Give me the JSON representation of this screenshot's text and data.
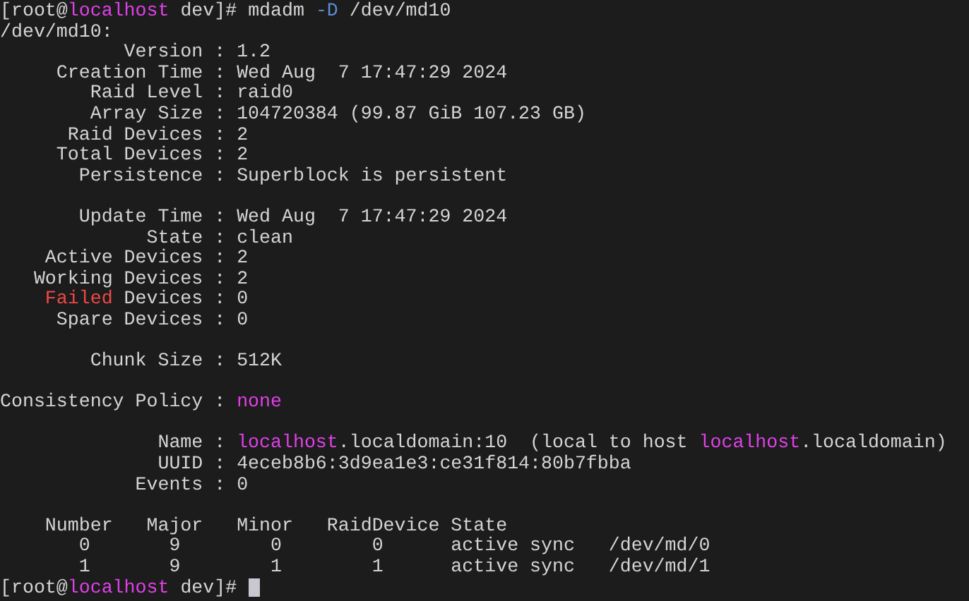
{
  "terminal": {
    "lines": [
      {
        "kind": "text",
        "segments": [
          {
            "text": "[root@",
            "kind": "plain"
          },
          {
            "text": "localhost",
            "kind": "host"
          },
          {
            "text": " dev]# mdadm ",
            "kind": "plain"
          },
          {
            "text": "-D",
            "kind": "flag"
          },
          {
            "text": " /dev/md10",
            "kind": "plain"
          }
        ]
      },
      {
        "kind": "text",
        "segments": [
          {
            "text": "/dev/md10:",
            "kind": "plain"
          }
        ]
      },
      {
        "kind": "text",
        "segments": [
          {
            "text": "           Version : 1.2",
            "kind": "plain"
          }
        ]
      },
      {
        "kind": "text",
        "segments": [
          {
            "text": "     Creation Time : Wed Aug  7 17:47:29 2024",
            "kind": "plain"
          }
        ]
      },
      {
        "kind": "text",
        "segments": [
          {
            "text": "        Raid Level : raid0",
            "kind": "plain"
          }
        ]
      },
      {
        "kind": "text",
        "segments": [
          {
            "text": "        Array Size : 104720384 (99.87 GiB 107.23 GB)",
            "kind": "plain"
          }
        ]
      },
      {
        "kind": "text",
        "segments": [
          {
            "text": "      Raid Devices : 2",
            "kind": "plain"
          }
        ]
      },
      {
        "kind": "text",
        "segments": [
          {
            "text": "     Total Devices : 2",
            "kind": "plain"
          }
        ]
      },
      {
        "kind": "text",
        "segments": [
          {
            "text": "       Persistence : Superblock is persistent",
            "kind": "plain"
          }
        ]
      },
      {
        "kind": "blank"
      },
      {
        "kind": "text",
        "segments": [
          {
            "text": "       Update Time : Wed Aug  7 17:47:29 2024",
            "kind": "plain"
          }
        ]
      },
      {
        "kind": "text",
        "segments": [
          {
            "text": "             State : clean",
            "kind": "plain"
          }
        ]
      },
      {
        "kind": "text",
        "segments": [
          {
            "text": "    Active Devices : 2",
            "kind": "plain"
          }
        ]
      },
      {
        "kind": "text",
        "segments": [
          {
            "text": "   Working Devices : 2",
            "kind": "plain"
          }
        ]
      },
      {
        "kind": "text",
        "segments": [
          {
            "text": "    Failed",
            "kind": "error"
          },
          {
            "text": " Devices : 0",
            "kind": "plain"
          }
        ]
      },
      {
        "kind": "text",
        "segments": [
          {
            "text": "     Spare Devices : 0",
            "kind": "plain"
          }
        ]
      },
      {
        "kind": "blank"
      },
      {
        "kind": "text",
        "segments": [
          {
            "text": "        Chunk Size : 512K",
            "kind": "plain"
          }
        ]
      },
      {
        "kind": "blank"
      },
      {
        "kind": "text",
        "segments": [
          {
            "text": "Consistency Policy : ",
            "kind": "plain"
          },
          {
            "text": "none",
            "kind": "host"
          }
        ]
      },
      {
        "kind": "blank"
      },
      {
        "kind": "text",
        "segments": [
          {
            "text": "              Name : ",
            "kind": "plain"
          },
          {
            "text": "localhost",
            "kind": "host"
          },
          {
            "text": ".localdomain:10  (local to host ",
            "kind": "plain"
          },
          {
            "text": "localhost",
            "kind": "host"
          },
          {
            "text": ".localdomain)",
            "kind": "plain"
          }
        ]
      },
      {
        "kind": "text",
        "segments": [
          {
            "text": "              UUID : 4eceb8b6:3d9ea1e3:ce31f814:80b7fbba",
            "kind": "plain"
          }
        ]
      },
      {
        "kind": "text",
        "segments": [
          {
            "text": "            Events : 0",
            "kind": "plain"
          }
        ]
      },
      {
        "kind": "blank"
      },
      {
        "kind": "text",
        "segments": [
          {
            "text": "    Number   Major   Minor   RaidDevice State",
            "kind": "plain"
          }
        ]
      },
      {
        "kind": "text",
        "segments": [
          {
            "text": "       0       9        0        0      active sync   /dev/md/0",
            "kind": "plain"
          }
        ]
      },
      {
        "kind": "text",
        "segments": [
          {
            "text": "       1       9        1        1      active sync   /dev/md/1",
            "kind": "plain"
          }
        ]
      },
      {
        "kind": "prompt",
        "segments": [
          {
            "text": "[root@",
            "kind": "plain"
          },
          {
            "text": "localhost",
            "kind": "host"
          },
          {
            "text": " dev]# ",
            "kind": "plain"
          }
        ]
      }
    ]
  }
}
